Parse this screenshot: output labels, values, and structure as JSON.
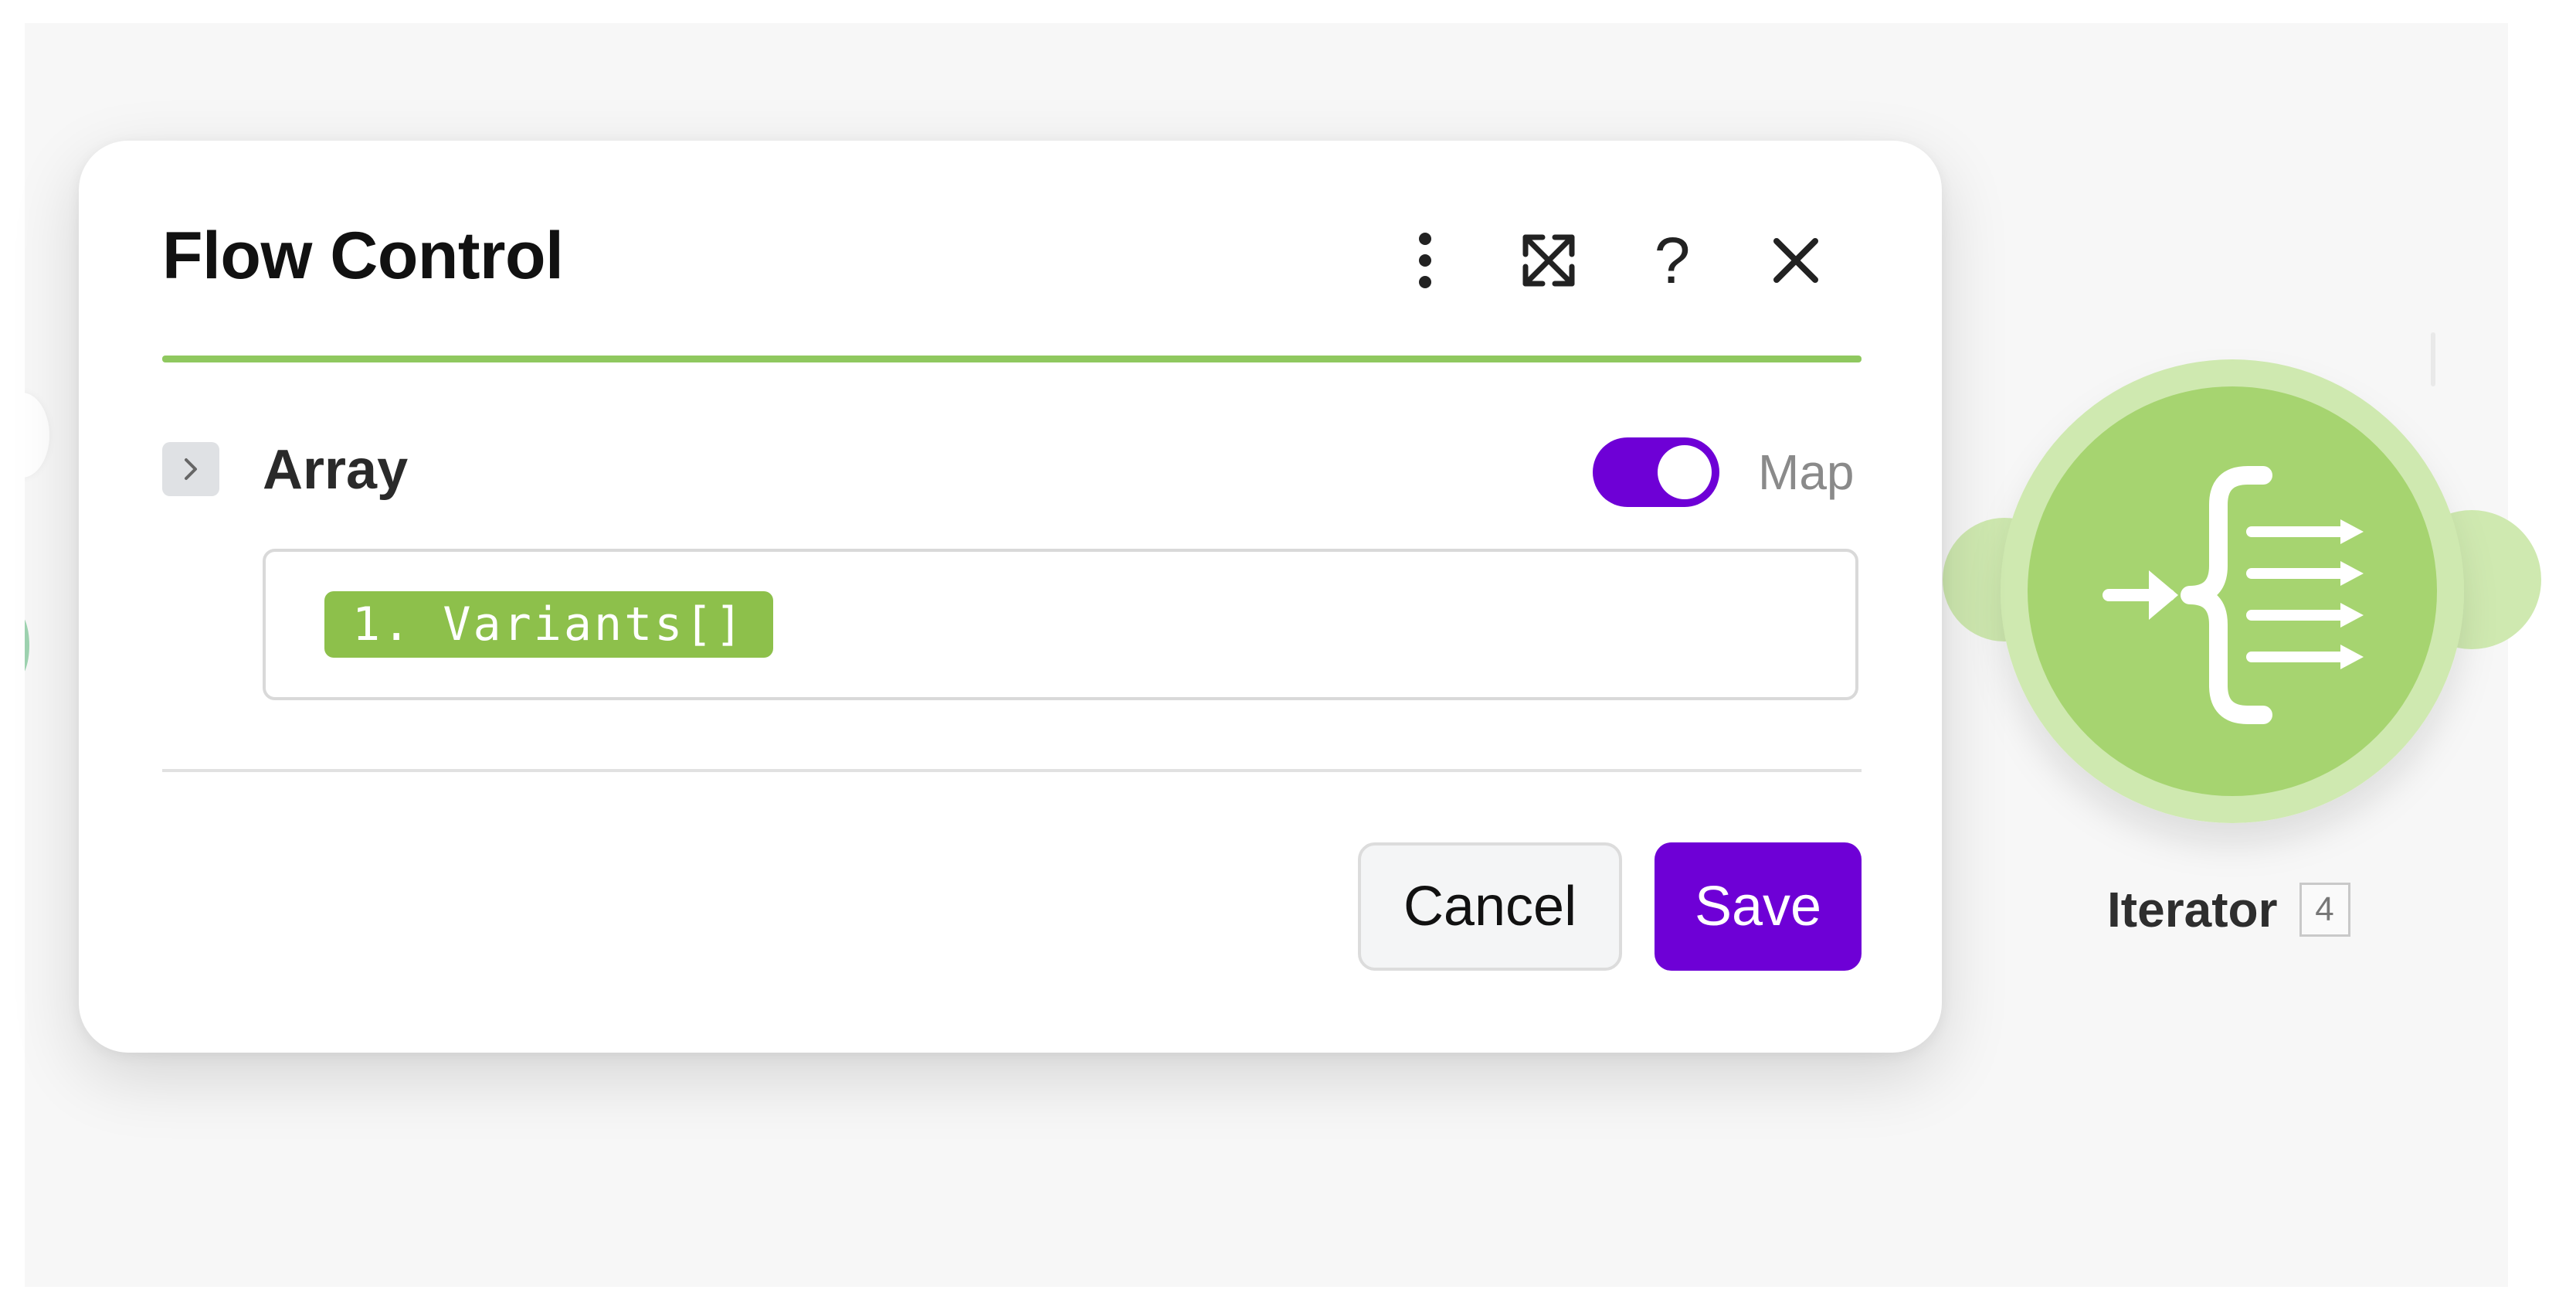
{
  "dialog": {
    "title": "Flow Control",
    "field": {
      "label": "Array",
      "map_label": "Map",
      "map_enabled": true,
      "value_token": "1. Variants[]"
    },
    "buttons": {
      "cancel": "Cancel",
      "save": "Save"
    },
    "header_icons": [
      "more-vertical-icon",
      "expand-icon",
      "help-icon",
      "close-icon"
    ],
    "help_glyph": "?"
  },
  "module": {
    "name": "Iterator",
    "badge": "4",
    "icon": "iterator-icon"
  },
  "colors": {
    "accent_purple": "#6e00d6",
    "accent_green": "#8fc85f",
    "token_green": "#8dc04b",
    "module_green": "#a6d470",
    "module_halo": "#cfe9b0"
  }
}
